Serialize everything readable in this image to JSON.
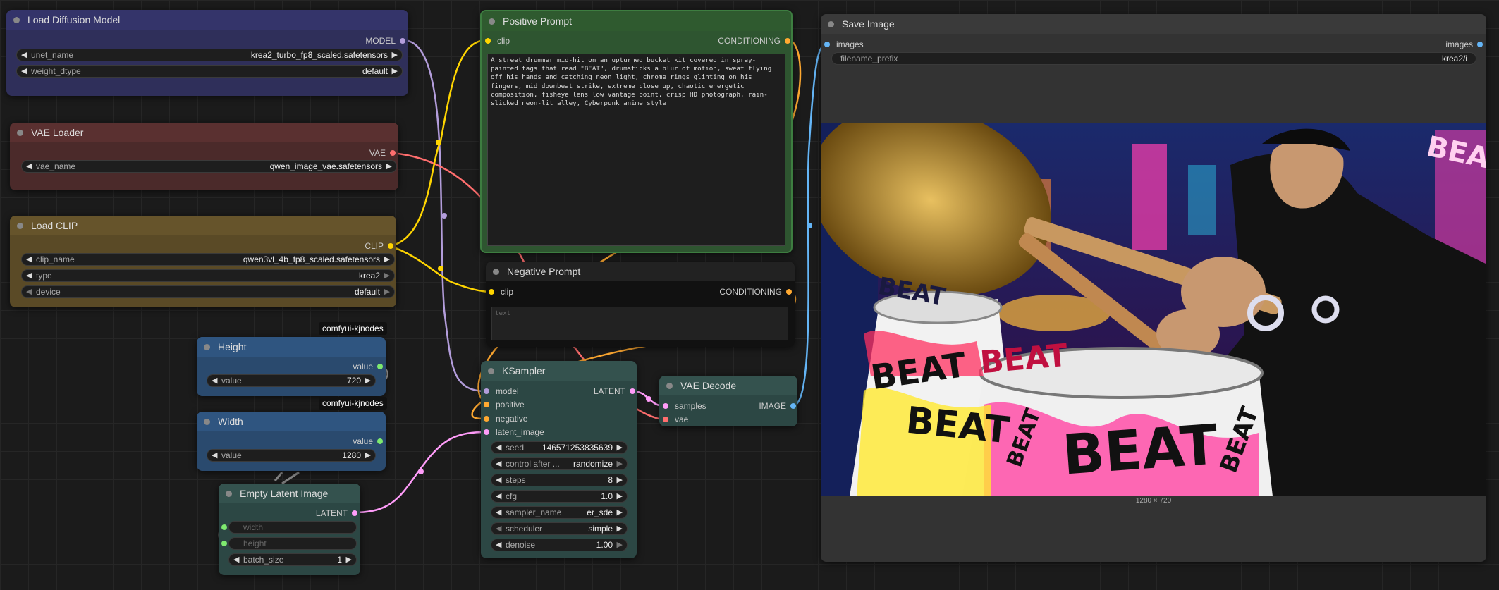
{
  "nodes": {
    "load_diffusion": {
      "title": "Load Diffusion Model",
      "output": "MODEL",
      "widgets": [
        {
          "label": "unet_name",
          "value": "krea2_turbo_fp8_scaled.safetensors"
        },
        {
          "label": "weight_dtype",
          "value": "default"
        }
      ]
    },
    "vae_loader": {
      "title": "VAE Loader",
      "output": "VAE",
      "widgets": [
        {
          "label": "vae_name",
          "value": "qwen_image_vae.safetensors"
        }
      ]
    },
    "load_clip": {
      "title": "Load CLIP",
      "output": "CLIP",
      "widgets": [
        {
          "label": "clip_name",
          "value": "qwen3vl_4b_fp8_scaled.safetensors"
        },
        {
          "label": "type",
          "value": "krea2"
        },
        {
          "label": "device",
          "value": "default"
        }
      ]
    },
    "height": {
      "badge": "comfyui-kjnodes",
      "title": "Height",
      "output": "value",
      "widgets": [
        {
          "label": "value",
          "value": "720"
        }
      ]
    },
    "width": {
      "badge": "comfyui-kjnodes",
      "title": "Width",
      "output": "value",
      "widgets": [
        {
          "label": "value",
          "value": "1280"
        }
      ]
    },
    "empty_latent": {
      "title": "Empty Latent Image",
      "output": "LATENT",
      "inputs": [
        "width",
        "height"
      ],
      "widgets": [
        {
          "label": "batch_size",
          "value": "1"
        }
      ]
    },
    "positive_prompt": {
      "title": "Positive Prompt",
      "input": "clip",
      "output": "CONDITIONING",
      "text": "A street drummer mid-hit on an upturned bucket kit covered in spray-painted tags that read \"BEAT\", drumsticks a blur of motion, sweat flying off his hands and catching neon light, chrome rings glinting on his fingers, mid downbeat strike, extreme close up, chaotic energetic composition, fisheye lens low vantage point, crisp HD photograph, rain-slicked neon-lit alley, Cyberpunk anime style"
    },
    "negative_prompt": {
      "title": "Negative Prompt",
      "input": "clip",
      "output": "CONDITIONING",
      "placeholder": "text"
    },
    "ksampler": {
      "title": "KSampler",
      "inputs": [
        "model",
        "positive",
        "negative",
        "latent_image"
      ],
      "output": "LATENT",
      "widgets": [
        {
          "label": "seed",
          "value": "146571253835639"
        },
        {
          "label": "control after ...",
          "value": "randomize"
        },
        {
          "label": "steps",
          "value": "8"
        },
        {
          "label": "cfg",
          "value": "1.0"
        },
        {
          "label": "sampler_name",
          "value": "er_sde"
        },
        {
          "label": "scheduler",
          "value": "simple"
        },
        {
          "label": "denoise",
          "value": "1.00"
        }
      ]
    },
    "vae_decode": {
      "title": "VAE Decode",
      "inputs": [
        "samples",
        "vae"
      ],
      "output": "IMAGE"
    },
    "save_image": {
      "title": "Save Image",
      "input": "images",
      "output": "images",
      "widgets": [
        {
          "label": "filename_prefix",
          "value": "krea2/i"
        }
      ],
      "image_size_label": "1280 × 720",
      "image_texts": [
        "BEAT",
        "BEAT",
        "BEAT",
        "BEAT",
        "BEAT",
        "BEAT",
        "BEAT",
        "BEAT"
      ]
    }
  },
  "colors": {
    "model": "#b39ddb",
    "vae": "#ff6e6e",
    "clip": "#ffd500",
    "conditioning": "#ffa931",
    "latent": "#ff9cf9",
    "image": "#64b5f6",
    "int": "#7eea6f"
  }
}
